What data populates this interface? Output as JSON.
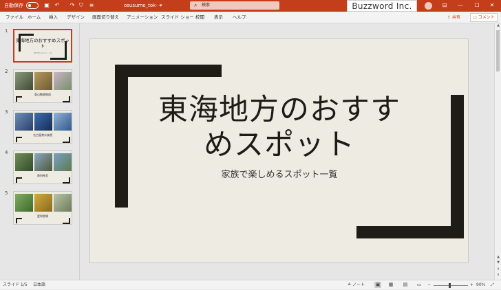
{
  "titlebar": {
    "autosave_label": "自動保存",
    "file_name": "osusume_tok···",
    "file_dropdown": "▾",
    "search_placeholder": "検索",
    "brand": "Buzzword Inc.",
    "qa_save": "▣",
    "qa_undo": "↶",
    "qa_redo": "↷",
    "qa_present": "⛉",
    "qa_more": "≡",
    "win_ribbon": "⊟",
    "win_min": "—",
    "win_max": "☐",
    "win_close": "✕"
  },
  "menu": {
    "items": [
      "ファイル",
      "ホーム",
      "挿入",
      "デザイン",
      "画面切り替え",
      "アニメーション",
      "スライド ショー",
      "校閲",
      "表示",
      "ヘルプ"
    ],
    "share_label": "共有",
    "comment_label": "コメント"
  },
  "thumbnails": [
    {
      "num": "1",
      "title": "東海地方のおすすめスポット",
      "subtitle": "家族で楽しめるスポット一覧"
    },
    {
      "num": "2",
      "caption": "東山動植物園"
    },
    {
      "num": "3",
      "caption": "名古屋港水族館"
    },
    {
      "num": "4",
      "caption": "熱田神宮"
    },
    {
      "num": "5",
      "caption": "愛知牧場"
    }
  ],
  "slide": {
    "title_line1": "東海地方のおすす",
    "title_line2": "めスポット",
    "subtitle": "家族で楽しめるスポット一覧"
  },
  "status": {
    "slide_counter": "スライド 1/5",
    "language": "日本語",
    "notes_label": "ノート",
    "zoom_minus": "−",
    "zoom_plus": "+",
    "zoom": "90%"
  },
  "colors": {
    "accent": "#c43e1c",
    "slide_bg": "#eeebe3",
    "bracket": "#1d1c16"
  }
}
